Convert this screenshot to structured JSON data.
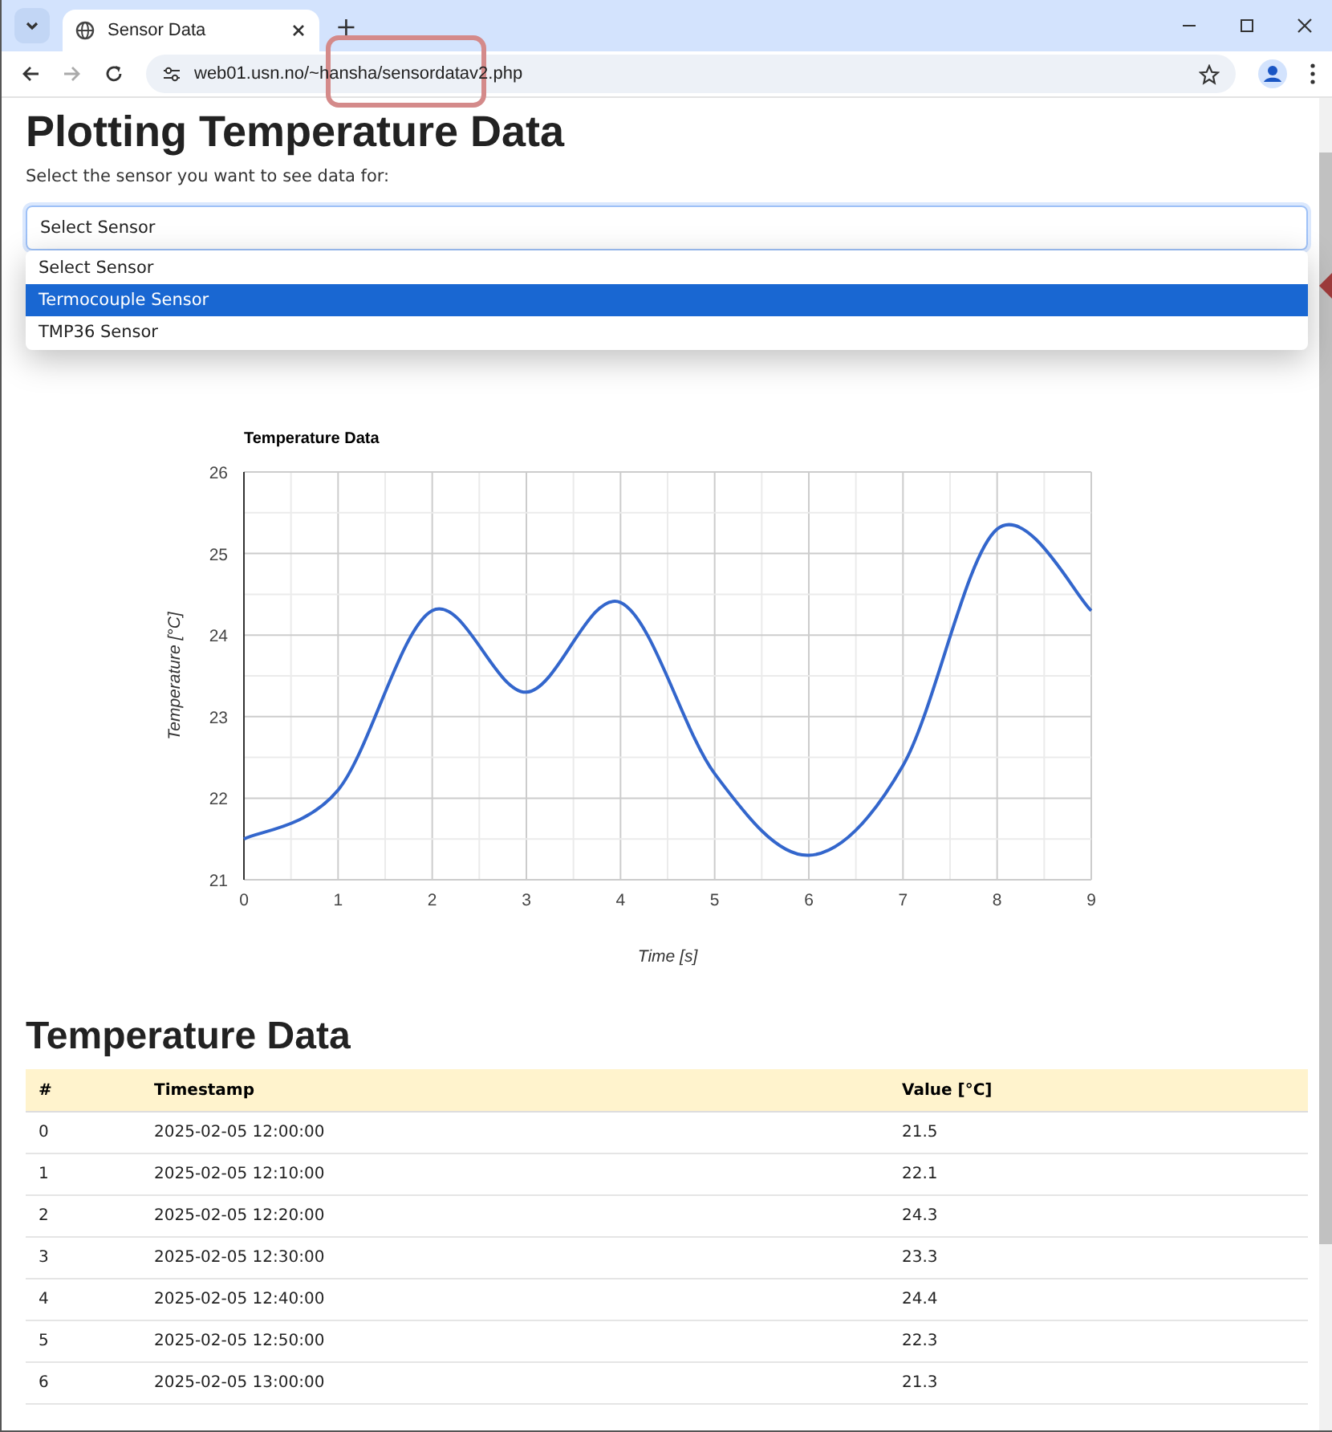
{
  "browser": {
    "tab_title": "Sensor Data",
    "new_tab": "+",
    "url": "web01.usn.no/~hansha/sensordatav2.php"
  },
  "page": {
    "heading": "Plotting Temperature Data",
    "prompt": "Select the sensor you want to see data for:",
    "sensor_select": {
      "value": "Select Sensor",
      "expanded": true,
      "options": [
        {
          "label": "Select Sensor",
          "highlighted": false
        },
        {
          "label": "Termocouple Sensor",
          "highlighted": true
        },
        {
          "label": "TMP36 Sensor",
          "highlighted": false
        }
      ]
    },
    "chart_data": {
      "type": "line",
      "title": "Temperature Data",
      "xlabel": "Time [s]",
      "ylabel": "Temperature [°C]",
      "x": [
        0,
        1,
        2,
        3,
        4,
        5,
        6,
        7,
        8,
        9
      ],
      "series": [
        {
          "color": "#3366cc",
          "values": [
            21.5,
            22.1,
            24.3,
            23.3,
            24.4,
            22.3,
            21.3,
            22.4,
            25.3,
            24.3
          ]
        }
      ],
      "grid": true,
      "xlim": [
        0,
        9
      ],
      "ylim": [
        21,
        26
      ],
      "xticks": [
        0,
        1,
        2,
        3,
        4,
        5,
        6,
        7,
        8,
        9
      ],
      "yticks": [
        21,
        22,
        23,
        24,
        25,
        26
      ]
    },
    "table_heading": "Temperature Data",
    "table": {
      "columns": [
        "#",
        "Timestamp",
        "Value [°C]"
      ],
      "rows": [
        [
          "0",
          "2025-02-05 12:00:00",
          "21.5"
        ],
        [
          "1",
          "2025-02-05 12:10:00",
          "22.1"
        ],
        [
          "2",
          "2025-02-05 12:20:00",
          "24.3"
        ],
        [
          "3",
          "2025-02-05 12:30:00",
          "23.3"
        ],
        [
          "4",
          "2025-02-05 12:40:00",
          "24.4"
        ],
        [
          "5",
          "2025-02-05 12:50:00",
          "22.3"
        ],
        [
          "6",
          "2025-02-05 13:00:00",
          "21.3"
        ]
      ]
    }
  }
}
